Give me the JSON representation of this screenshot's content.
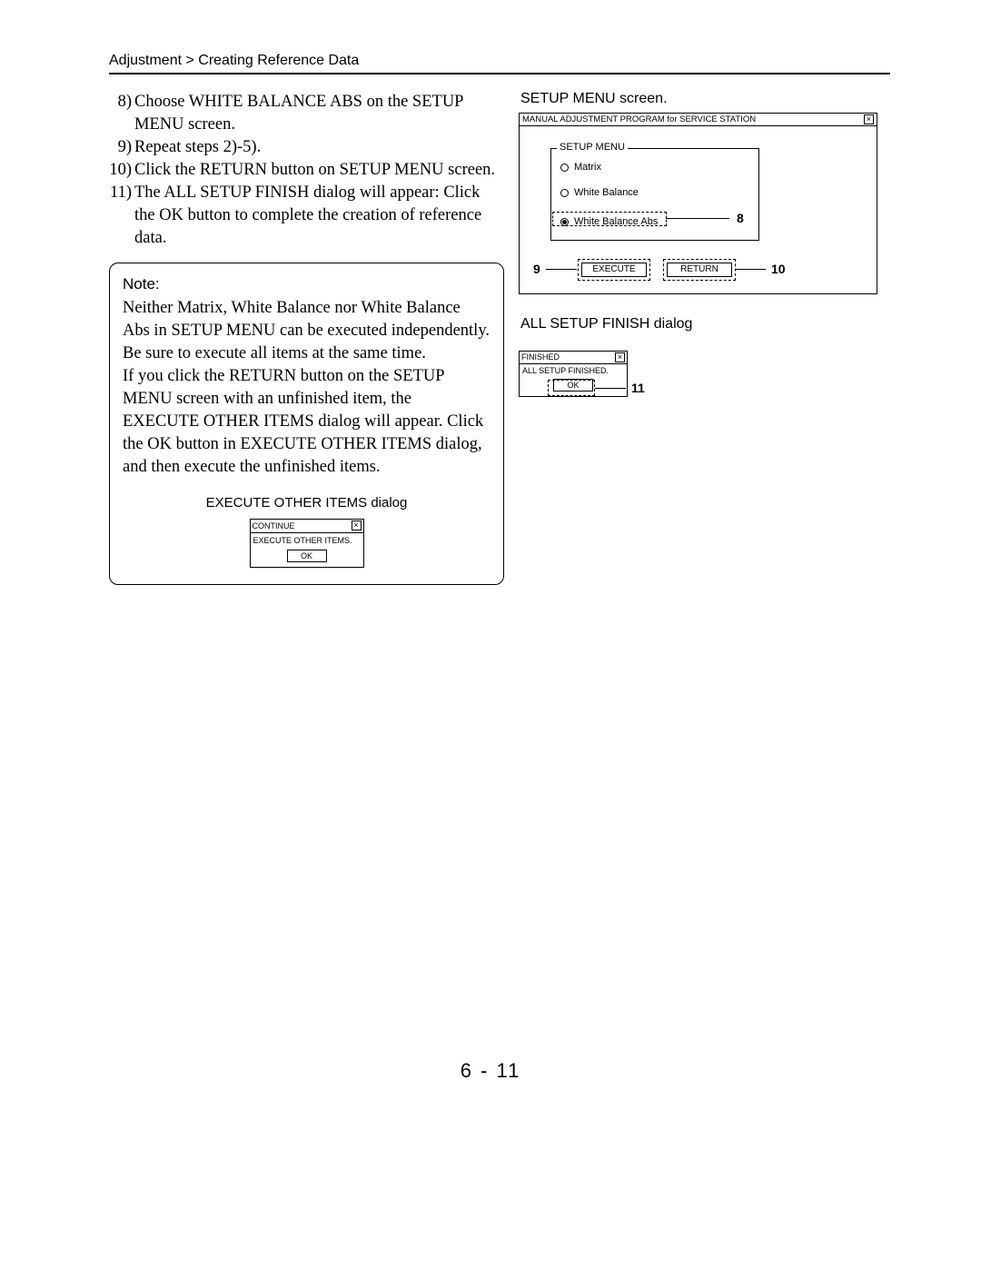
{
  "breadcrumb": "Adjustment > Creating Reference Data",
  "steps": [
    {
      "n": "8)",
      "t": "Choose WHITE BALANCE ABS on the SETUP MENU screen."
    },
    {
      "n": "9)",
      "t": "Repeat steps 2)-5)."
    },
    {
      "n": "10)",
      "t": "Click the RETURN button on SETUP MENU screen."
    },
    {
      "n": "11)",
      "t": "The ALL SETUP FINISH dialog will appear: Click the OK button to complete the creation of reference data."
    }
  ],
  "note": {
    "head": "Note:",
    "para1": "Neither Matrix, White Balance nor White Balance Abs in SETUP MENU can be executed independently. Be sure to execute all items at the same time.",
    "para2": "If you click the RETURN button on the SETUP MENU screen with an unfinished item, the EXECUTE OTHER ITEMS dialog will appear. Click the OK button in EXECUTE OTHER ITEMS dialog, and then execute the unfinished items.",
    "eoi_caption": "EXECUTE  OTHER  ITEMS  dialog",
    "eoi": {
      "title": "CONTINUE",
      "message": "EXECUTE OTHER ITEMS.",
      "ok": "OK"
    }
  },
  "right": {
    "setup_caption": "SETUP  MENU  screen.",
    "window_title": "MANUAL ADJUSTMENT PROGRAM for SERVICE STATION",
    "fieldset_legend": "SETUP MENU",
    "opt1": "Matrix",
    "opt2": "White Balance",
    "opt3": "White Balance Abs",
    "execute": "EXECUTE",
    "return": "RETURN",
    "callout_8": "8",
    "callout_9": "9",
    "callout_10": "10",
    "finish_caption": "ALL  SETUP  FINISH  dialog",
    "finish": {
      "title": "FINISHED",
      "message": "ALL SETUP FINISHED.",
      "ok": "OK"
    },
    "callout_11": "11"
  },
  "page_number": "6 - 11"
}
